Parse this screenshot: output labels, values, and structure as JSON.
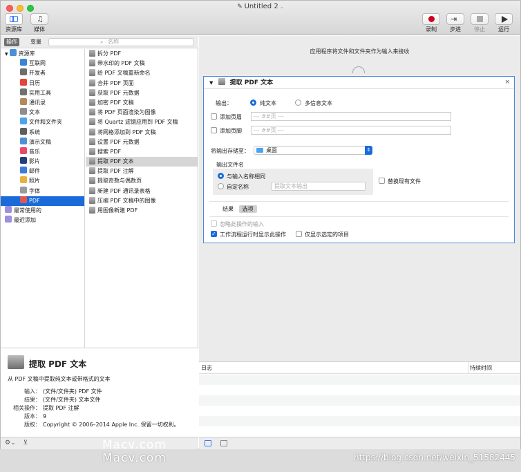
{
  "window": {
    "title": "Untitled 2"
  },
  "toolbar": {
    "library_label": "资源库",
    "media_label": "媒体",
    "record_label": "录制",
    "step_label": "步进",
    "stop_label": "停止",
    "run_label": "运行"
  },
  "left": {
    "tab_actions": "操作",
    "tab_variables": "变量",
    "search_placeholder": "名称"
  },
  "categories": [
    {
      "label": "资源库",
      "color": "#4a90d9",
      "type": "root"
    },
    {
      "label": "互联网",
      "color": "#3a84d6",
      "type": "child"
    },
    {
      "label": "开发者",
      "color": "#6d6d6d",
      "type": "child"
    },
    {
      "label": "日历",
      "color": "#e3433b",
      "type": "child"
    },
    {
      "label": "实用工具",
      "color": "#707070",
      "type": "child"
    },
    {
      "label": "通讯录",
      "color": "#b28a5e",
      "type": "child"
    },
    {
      "label": "文本",
      "color": "#8e8e8e",
      "type": "child"
    },
    {
      "label": "文件和文件夹",
      "color": "#4ea3ee",
      "type": "child"
    },
    {
      "label": "系统",
      "color": "#5e5e5e",
      "type": "child"
    },
    {
      "label": "演示文稿",
      "color": "#4f8fd8",
      "type": "child"
    },
    {
      "label": "音乐",
      "color": "#e84a6a",
      "type": "child"
    },
    {
      "label": "影片",
      "color": "#233f7a",
      "type": "child"
    },
    {
      "label": "邮件",
      "color": "#3d7bd6",
      "type": "child"
    },
    {
      "label": "照片",
      "color": "#e9b040",
      "type": "child"
    },
    {
      "label": "字体",
      "color": "#9a9a9a",
      "type": "child"
    },
    {
      "label": "PDF",
      "color": "#e2574c",
      "type": "child",
      "selected": true
    },
    {
      "label": "最常使用的",
      "color": "#9a8fe0",
      "type": "root"
    },
    {
      "label": "最近添加",
      "color": "#9a8fe0",
      "type": "root"
    }
  ],
  "actions": [
    {
      "label": "拆分 PDF"
    },
    {
      "label": "带水印的 PDF 文稿"
    },
    {
      "label": "给 PDF 文稿重新命名"
    },
    {
      "label": "合并 PDF 页面"
    },
    {
      "label": "获取 PDF 元数据"
    },
    {
      "label": "加密 PDF 文稿"
    },
    {
      "label": "将 PDF 页面渲染为图像"
    },
    {
      "label": "将 Quartz 滤镜应用到 PDF 文稿"
    },
    {
      "label": "将网格添加到 PDF 文稿"
    },
    {
      "label": "设置 PDF 元数据"
    },
    {
      "label": "搜索 PDF"
    },
    {
      "label": "提取 PDF 文本",
      "selected": true
    },
    {
      "label": "提取 PDF 注解"
    },
    {
      "label": "提取奇数与偶数页"
    },
    {
      "label": "新建 PDF 通讯录表格"
    },
    {
      "label": "压缩 PDF 文稿中的图像"
    },
    {
      "label": "用图像新建 PDF"
    }
  ],
  "description": {
    "title": "提取 PDF 文本",
    "subtitle": "从 PDF 文稿中提取纯文本或带格式的文本",
    "rows": [
      {
        "key": "输入：",
        "value": "(文件/文件夹) PDF 文件"
      },
      {
        "key": "结果：",
        "value": "(文件/文件夹) 文本文件"
      },
      {
        "key": "相关操作：",
        "value": "提取 PDF 注解"
      },
      {
        "key": "版本：",
        "value": "9"
      },
      {
        "key": "版权：",
        "value": "Copyright © 2006–2014 Apple Inc. 保留一切权利。"
      }
    ]
  },
  "workflow": {
    "header_text": "应用程序将文件和文件夹作为输入来接收",
    "action": {
      "title": "提取 PDF 文本",
      "output_label": "输出：",
      "plain_text": "纯文本",
      "rich_text": "多信息文本",
      "add_header": "添加页眉",
      "add_footer": "添加页脚",
      "header_placeholder": "--- ##页 ---",
      "footer_placeholder": "--- ##页 ---",
      "save_to_label": "将输出存储至：",
      "save_to_value": "桌面",
      "filename_label": "输出文件名",
      "same_as_input": "与输入名称相同",
      "custom_name": "自定名称",
      "custom_placeholder": "提取文本输出",
      "replace_existing": "替换现有文件",
      "tab_results": "结果",
      "tab_options": "选项",
      "ignore_input": "忽略此操作的输入",
      "show_when_run": "工作流程运行时显示此操作",
      "show_selected_only": "仅显示选定的项目"
    }
  },
  "log": {
    "col_log": "日志",
    "col_duration": "持续时间"
  },
  "watermarks": {
    "site1": "Macv.com",
    "site2": "Macv.com",
    "url": "https://blog.csdn.net/weixin_51582445"
  }
}
